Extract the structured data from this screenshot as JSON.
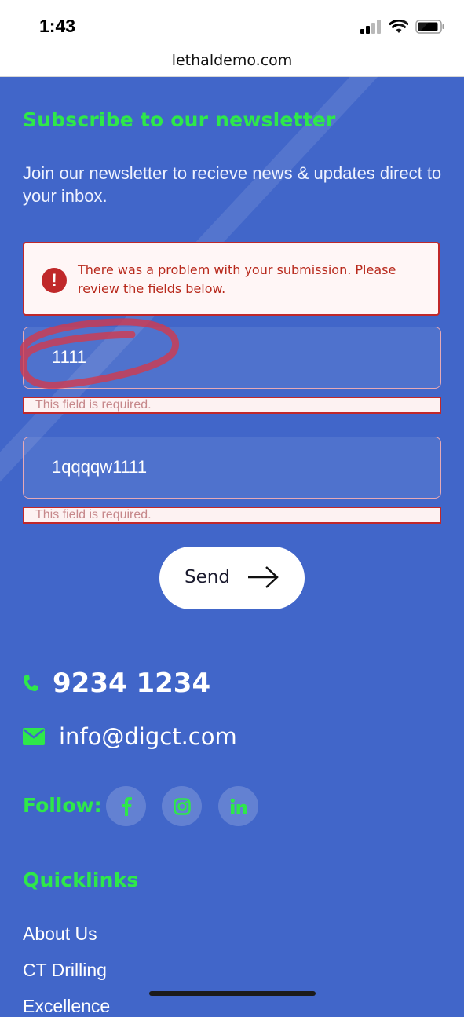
{
  "status_bar": {
    "time": "1:43"
  },
  "browser": {
    "url": "lethaldemo.com"
  },
  "newsletter": {
    "heading": "Subscribe to our newsletter",
    "intro": "Join our newsletter to recieve news & updates direct to your inbox.",
    "alert_text": "There was a problem with your submission. Please review the fields below.",
    "alert_icon": "exclamation-icon",
    "fields": [
      {
        "value": "1111",
        "error": "This field is required."
      },
      {
        "value": "1qqqqw1111",
        "error": "This field is required."
      }
    ],
    "send_label": "Send"
  },
  "contact": {
    "phone": "9234 1234",
    "email": "info@digct.com"
  },
  "follow": {
    "label": "Follow:",
    "icons": [
      "facebook-icon",
      "instagram-icon",
      "linkedin-icon"
    ]
  },
  "quicklinks": {
    "heading": "Quicklinks",
    "links": [
      "About Us",
      "CT Drilling",
      "Excellence"
    ]
  },
  "colors": {
    "background": "#4166c9",
    "accent_green": "#2ee84a",
    "error_red": "#c0282a"
  }
}
